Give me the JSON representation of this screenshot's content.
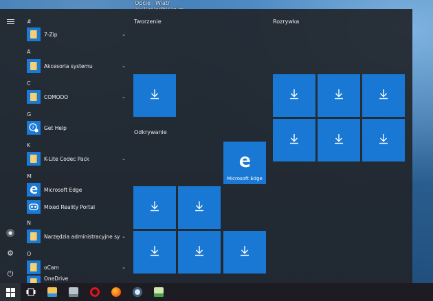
{
  "desktop": {
    "label_1": "Opcje\nzasilania",
    "label_2": "Wiatr\nodbicze.m"
  },
  "rail": {
    "menu_icon": "hamburger-icon",
    "account_icon": "user-icon",
    "settings_icon": "gear-icon",
    "power_icon": "power-icon"
  },
  "app_list": {
    "letters": [
      "#",
      "A",
      "C",
      "G",
      "K",
      "M",
      "N",
      "O"
    ],
    "apps": [
      {
        "label": "7-Zip",
        "icon": "folder-icon",
        "expandable": true
      },
      {
        "label": "Akcesoria systemu",
        "icon": "folder-icon",
        "expandable": true
      },
      {
        "label": "COMODO",
        "icon": "folder-icon",
        "expandable": true
      },
      {
        "label": "Get Help",
        "icon": "help-icon",
        "expandable": false
      },
      {
        "label": "K-Lite Codec Pack",
        "icon": "folder-icon",
        "expandable": true
      },
      {
        "label": "Microsoft Edge",
        "icon": "edge-icon",
        "expandable": false
      },
      {
        "label": "Mixed Reality Portal",
        "icon": "mixed-reality-icon",
        "expandable": false
      },
      {
        "label": "Narzędzia administracyjne sys...",
        "icon": "folder-icon",
        "expandable": true
      },
      {
        "label": "oCam",
        "icon": "folder-icon",
        "expandable": true
      },
      {
        "label": "OneDrive",
        "icon": "folder-icon",
        "expandable": false
      }
    ]
  },
  "groups": {
    "tworzenie": "Tworzenie",
    "odkrywanie": "Odkrywanie",
    "rozrywka": "Rozrywka"
  },
  "tiles": {
    "edge_label": "Microsoft Edge",
    "download_icon": "download-icon"
  },
  "colors": {
    "tile": "#1878d4",
    "menu_bg": "#21262c",
    "taskbar": "#1c1c22"
  },
  "taskbar": {
    "items": [
      "windows-start-icon",
      "task-view-icon",
      "file-explorer-icon",
      "network-icon",
      "opera-icon",
      "firefox-icon",
      "keepass-icon",
      "notepad-icon"
    ]
  }
}
